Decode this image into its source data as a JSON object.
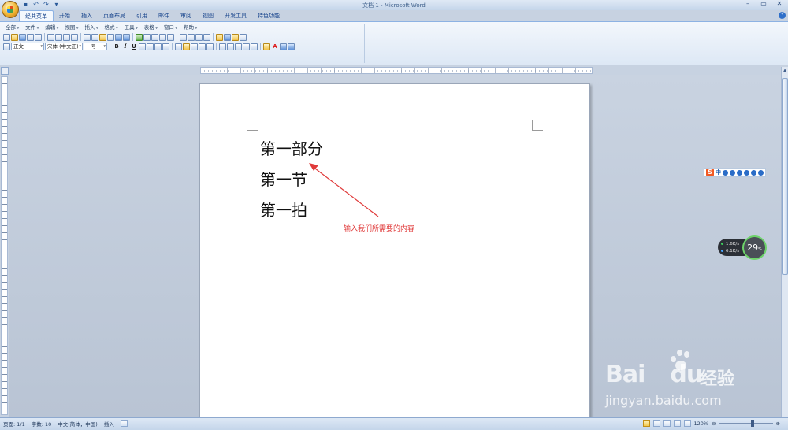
{
  "window": {
    "title": "文档 1 - Microsoft Word",
    "controls": [
      "–",
      "▭",
      "✕"
    ]
  },
  "quick_access": {
    "icons": [
      "save-icon",
      "undo-icon",
      "redo-icon",
      "customize-icon"
    ],
    "glyphs": [
      "▪",
      "↶",
      "↷",
      "▾"
    ]
  },
  "ribbon_tabs": [
    "经典菜单",
    "开始",
    "插入",
    "页面布局",
    "引用",
    "邮件",
    "审阅",
    "视图",
    "开发工具",
    "特色功能"
  ],
  "classic_menu": [
    "全部",
    "文件",
    "编辑",
    "视图",
    "插入",
    "格式",
    "工具",
    "表格",
    "窗口",
    "帮助"
  ],
  "format_bar": {
    "style": "正文",
    "font": "宋体 (中文正)",
    "size": "一号",
    "bold": "B",
    "italic": "I",
    "underline": "U",
    "font_color": "A"
  },
  "ruler_labels": [
    "8",
    "6",
    "4",
    "2",
    "2",
    "4",
    "6",
    "8",
    "10",
    "12",
    "14",
    "16",
    "18",
    "20",
    "22",
    "24",
    "26",
    "28",
    "30",
    "32",
    "34",
    "36",
    "38",
    "40",
    "42",
    "44",
    "46",
    "48"
  ],
  "document": {
    "lines": [
      "第一部分",
      "第一节",
      "第一拍"
    ],
    "annotation": "输入我们所需要的内容"
  },
  "ime": {
    "logo": "S",
    "mode": "中"
  },
  "network_widget": {
    "upload": "1.6K/s",
    "download": "6.1K/s",
    "percent": "29",
    "unit": "%"
  },
  "watermark": {
    "brand_left": "Bai",
    "brand_right": "du",
    "cn": "经验",
    "url": "jingyan.baidu.com"
  },
  "status_bar": {
    "page": "页面: 1/1",
    "words": "字数: 10",
    "language": "中文(简体，中国)",
    "mode": "插入",
    "zoom": "120%"
  },
  "colors": {
    "annotation": "#e03a3a",
    "ribbon_border": "#8db2e3",
    "page_bg": "#ffffff"
  }
}
